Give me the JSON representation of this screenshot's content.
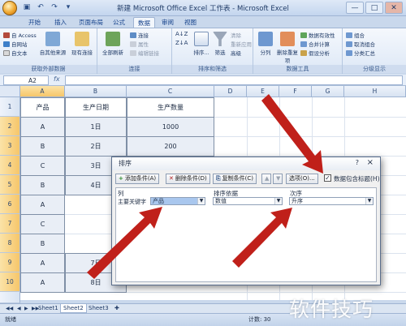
{
  "window": {
    "title": "新建 Microsoft Office Excel 工作表 - Microsoft Excel",
    "controls": [
      "—",
      "□",
      "✕"
    ]
  },
  "ribbon_tabs": [
    "开始",
    "插入",
    "页面布局",
    "公式",
    "数据",
    "审阅",
    "视图"
  ],
  "active_tab": "数据",
  "ribbon": {
    "external_data": {
      "label": "获取外部数据",
      "items": [
        "自 Access",
        "自网站",
        "自文本",
        "自其他来源",
        "现有连接"
      ]
    },
    "connections": {
      "label": "连接",
      "items": [
        "全部刷新",
        "连接",
        "属性",
        "编辑链接"
      ]
    },
    "sort_filter": {
      "label": "排序和筛选",
      "items": [
        "排序...",
        "筛选",
        "清除",
        "重新应用",
        "高级"
      ]
    },
    "data_tools": {
      "label": "数据工具",
      "items": [
        "分列",
        "删除重复项",
        "数据有效性",
        "合并计算",
        "假设分析"
      ]
    },
    "outline": {
      "label": "分级显示",
      "items": [
        "组合",
        "取消组合",
        "分类汇总"
      ]
    }
  },
  "formula_bar": {
    "name_box": "A2",
    "fx": "fx",
    "value": ""
  },
  "columns": [
    "A",
    "B",
    "C",
    "D",
    "E",
    "F",
    "G",
    "H"
  ],
  "rows": [
    "1",
    "2",
    "3",
    "4",
    "5",
    "6",
    "7",
    "8",
    "9",
    "10"
  ],
  "table": {
    "headers": [
      "产品",
      "生产日期",
      "生产数量"
    ],
    "rows": [
      [
        "A",
        "1日",
        "1000"
      ],
      [
        "B",
        "2日",
        "200"
      ],
      [
        "C",
        "3日",
        ""
      ],
      [
        "B",
        "4日",
        ""
      ],
      [
        "A",
        "2日",
        ""
      ],
      [
        "C",
        "5日",
        ""
      ],
      [
        "B",
        "6日",
        ""
      ],
      [
        "A",
        "7日",
        ""
      ],
      [
        "A",
        "8日",
        ""
      ]
    ]
  },
  "sheets": [
    "Sheet1",
    "Sheet2",
    "Sheet3"
  ],
  "active_sheet": "Sheet2",
  "status": {
    "left": "就绪",
    "count": "计数: 30"
  },
  "sort_dialog": {
    "title": "排序",
    "help": "?",
    "close": "×",
    "buttons": [
      {
        "icon": "+",
        "label": "添加条件(A)"
      },
      {
        "icon": "✕",
        "label": "删除条件(D)"
      },
      {
        "icon": "⎘",
        "label": "复制条件(C)"
      },
      {
        "icon": "▲",
        "label": ""
      },
      {
        "icon": "▼",
        "label": ""
      },
      {
        "icon": "",
        "label": "选项(O)..."
      }
    ],
    "has_headers_label": "数据包含标题(H)",
    "has_headers_checked": "✓",
    "col_header": "列",
    "sort_on_header": "排序依据",
    "order_header": "次序",
    "row_label": "主要关键字",
    "key_value": "产品",
    "sort_on_value": "数值",
    "order_value": "升序"
  },
  "watermark": "软件技巧",
  "accent_arrow_color": "#c0201a"
}
